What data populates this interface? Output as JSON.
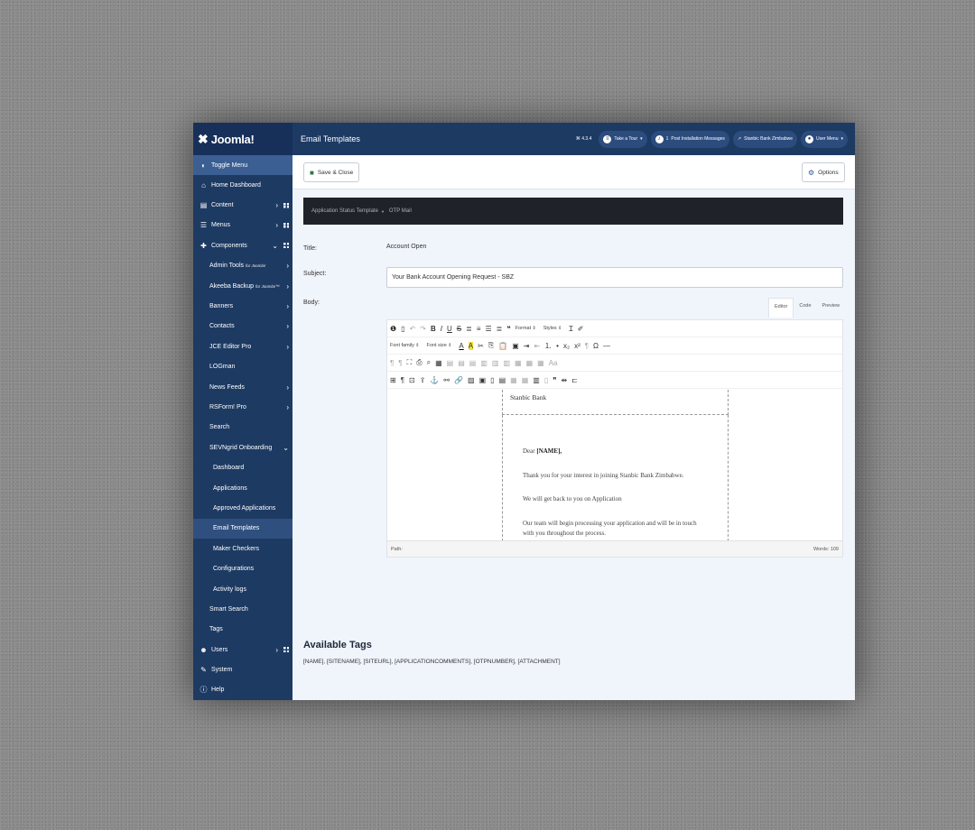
{
  "brand": {
    "name": "Joomla!"
  },
  "header": {
    "title": "Email Templates",
    "version": "⌘ 4.3.4",
    "take_tour": "Take a Tour",
    "messages_count": "1",
    "post_install": "Post Installation Messages",
    "site_name": "Stanbic Bank Zimbabwe",
    "user_menu": "User Menu"
  },
  "sidebar": {
    "toggle": "Toggle Menu",
    "home": "Home Dashboard",
    "content": "Content",
    "menus": "Menus",
    "components": "Components",
    "admin_tools": "Admin Tools",
    "admin_tools_note": "for Joomla!",
    "akeeba": "Akeeba Backup",
    "akeeba_note": "for Joomla!™",
    "banners": "Banners",
    "contacts": "Contacts",
    "jce": "JCE Editor Pro",
    "logman": "LOGman",
    "newsfeeds": "News Feeds",
    "rsform": "RSForm! Pro",
    "search": "Search",
    "sevngrid": "SEVNgrid Onboarding",
    "dashboard": "Dashboard",
    "applications": "Applications",
    "approved": "Approved Applications",
    "email_templates": "Email Templates",
    "maker_checkers": "Maker Checkers",
    "configurations": "Configurations",
    "activity_logs": "Activity logs",
    "smart_search": "Smart Search",
    "tags": "Tags",
    "users": "Users",
    "system": "System",
    "help": "Help"
  },
  "toolbar": {
    "save_close": "Save & Close",
    "options": "Options"
  },
  "tabs": {
    "template": "Application Status Template",
    "otp": "OTP Mail"
  },
  "form": {
    "title_label": "Title:",
    "title_value": "Account Open",
    "subject_label": "Subject:",
    "subject_value": "Your Bank Account Opening Request - SBZ",
    "body_label": "Body:"
  },
  "editor": {
    "tab_editor": "Editor",
    "tab_code": "Code",
    "tab_preview": "Preview",
    "format": "Format",
    "styles": "Styles",
    "font_family": "Font family",
    "font_size": "Font size",
    "path": "Path:",
    "words": "Words: 109"
  },
  "email": {
    "bank": "Stanbic Bank",
    "dear": "Dear",
    "name_tag": "[NAME],",
    "line1": "Thank you for your interest in joining Stanbic Bank Zimbabwe.",
    "line2": "We will get back to you on Application",
    "line3": "Our team will begin processing your application and will be in touch with you throughout the process."
  },
  "tags_section": {
    "heading": "Available Tags",
    "list": "[NAME], [SITENAME], [SITEURL], [APPLICATIONCOMMENTS], [OTPNUMBER], [ATTACHMENT]"
  }
}
